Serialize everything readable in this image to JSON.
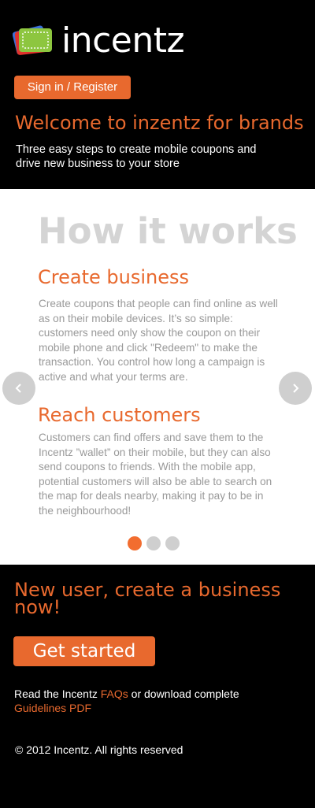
{
  "header": {
    "logo_text": "incentz",
    "signin_label": "Sign in / Register",
    "welcome": "Welcome to inzentz for brands",
    "intro": "Three easy steps to create mobile coupons and drive new business to your store"
  },
  "how": {
    "title": "How it works",
    "steps": [
      {
        "title": "Create business",
        "body": "Create coupons that people can find online as well as on their mobile devices. It’s so simple: customers need only show the coupon on their mobile phone and click \"Redeem\" to make the transaction. You control how long a campaign is active and what your terms are."
      },
      {
        "title": "Reach customers",
        "body": "Customers can find offers and save them to the Incentz ”wallet” on their mobile, but they can also send coupons to friends.  With the mobile app, potential customers will also be able to search on the map for deals nearby, making it pay to be in the neighbourhood!"
      }
    ],
    "slides_total": 3,
    "active_slide": 1
  },
  "footer": {
    "cta_title": "New user, create a business now!",
    "getstarted_label": "Get started",
    "faq_prefix": "Read the Incentz ",
    "faq_link": "FAQs",
    "faq_middle": " or download complete ",
    "guidelines_link": "Guidelines PDF",
    "copyright": "© 2012 Incentz. All rights reserved"
  },
  "colors": {
    "accent": "#e8692e",
    "background": "#000000",
    "panel": "#ffffff",
    "muted_text": "#999999",
    "dot_inactive": "#cfcfcf"
  }
}
